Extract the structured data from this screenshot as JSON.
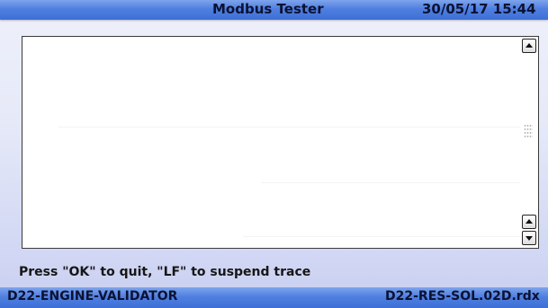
{
  "header": {
    "title": "Modbus Tester",
    "datetime": "30/05/17 15:44"
  },
  "trace": {
    "lines": []
  },
  "hint": "Press \"OK\" to quit, \"LF\" to suspend trace",
  "status": {
    "left": "D22-ENGINE-VALIDATOR",
    "right": "D22-RES-SOL.02D.rdx"
  },
  "colors": {
    "bar": "#4f7fe0",
    "background": "#e6e9f8"
  },
  "icons": {
    "scroll_up": "arrow-up-icon",
    "scroll_down": "arrow-down-icon"
  }
}
